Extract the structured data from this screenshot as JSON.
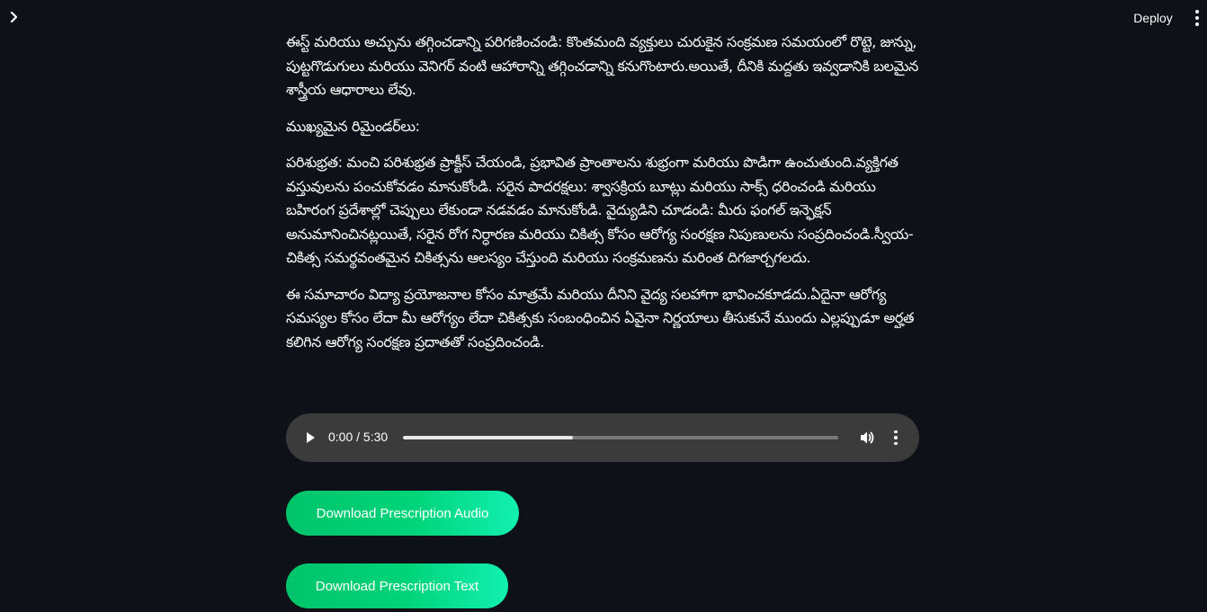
{
  "header": {
    "deploy_label": "Deploy",
    "sidebar_toggle_icon": "chevron-right-icon",
    "menu_icon": "vertical-dots-icon"
  },
  "content": {
    "paragraphs": [
      "ఈస్ట్ మరియు అచ్చును తగ్గించడాన్ని పరిగణించండి: కొంతమంది వ్యక్తులు చురుకైన సంక్రమణ సమయంలో రొట్టె, జున్ను, పుట్టగొడుగులు మరియు వెనిగర్ వంటి ఆహారాన్ని తగ్గించడాన్ని కనుగొంటారు.అయితే, దీనికి మద్దతు ఇవ్వడానికి బలమైన శాస్త్రీయ ఆధారాలు లేవు.",
      "ముఖ్యమైన రిమైండర్‌లు:",
      "పరిశుభ్రత: మంచి పరిశుభ్రత ప్రాక్టీస్ చేయండి, ప్రభావిత ప్రాంతాలను శుభ్రంగా మరియు పొడిగా ఉంచుతుంది.వ్యక్తిగత వస్తువులను పంచుకోవడం మానుకోండి. సరైన పాదరక్షలు: శ్వాసక్రియ బూట్లు మరియు సాక్స్ ధరించండి మరియు బహిరంగ ప్రదేశాల్లో చెప్పులు లేకుండా నడవడం మానుకోండి. వైద్యుడిని చూడండి: మీరు ఫంగల్ ఇన్ఫెక్షన్ అనుమానించినట్లయితే, సరైన రోగ నిర్ధారణ మరియు చికిత్స కోసం ఆరోగ్య సంరక్షణ నిపుణులను సంప్రదించండి.స్వీయ-చికిత్స సమర్థవంతమైన చికిత్సను ఆలస్యం చేస్తుంది మరియు సంక్రమణను మరింత దిగజార్చగలదు.",
      "ఈ సమాచారం విద్యా ప్రయోజనాల కోసం మాత్రమే మరియు దీనిని వైద్య సలహాగా భావించకూడదు.ఏదైనా ఆరోగ్య సమస్యల కోసం లేదా మీ ఆరోగ్యం లేదా చికిత్సకు సంబంధించిన ఏవైనా నిర్ణయాలు తీసుకునే ముందు ఎల్లప్పుడూ అర్హత కలిగిన ఆరోగ్య సంరక్షణ ప్రదాతతో సంప్రదించండి."
    ]
  },
  "audio_player": {
    "time_display": "0:00 / 5:30",
    "buffered_fraction": 0.39,
    "play_icon": "play-icon",
    "volume_icon": "volume-icon",
    "more_icon": "more-options-icon"
  },
  "buttons": {
    "download_audio_label": "Download Prescription Audio",
    "download_text_label": "Download Prescription Text"
  },
  "colors": {
    "background": "#0e1117",
    "text": "#fafafa",
    "audio_bg": "#3b3b3b",
    "button_gradient_start": "#00c46a",
    "button_gradient_end": "#12f0b0"
  }
}
